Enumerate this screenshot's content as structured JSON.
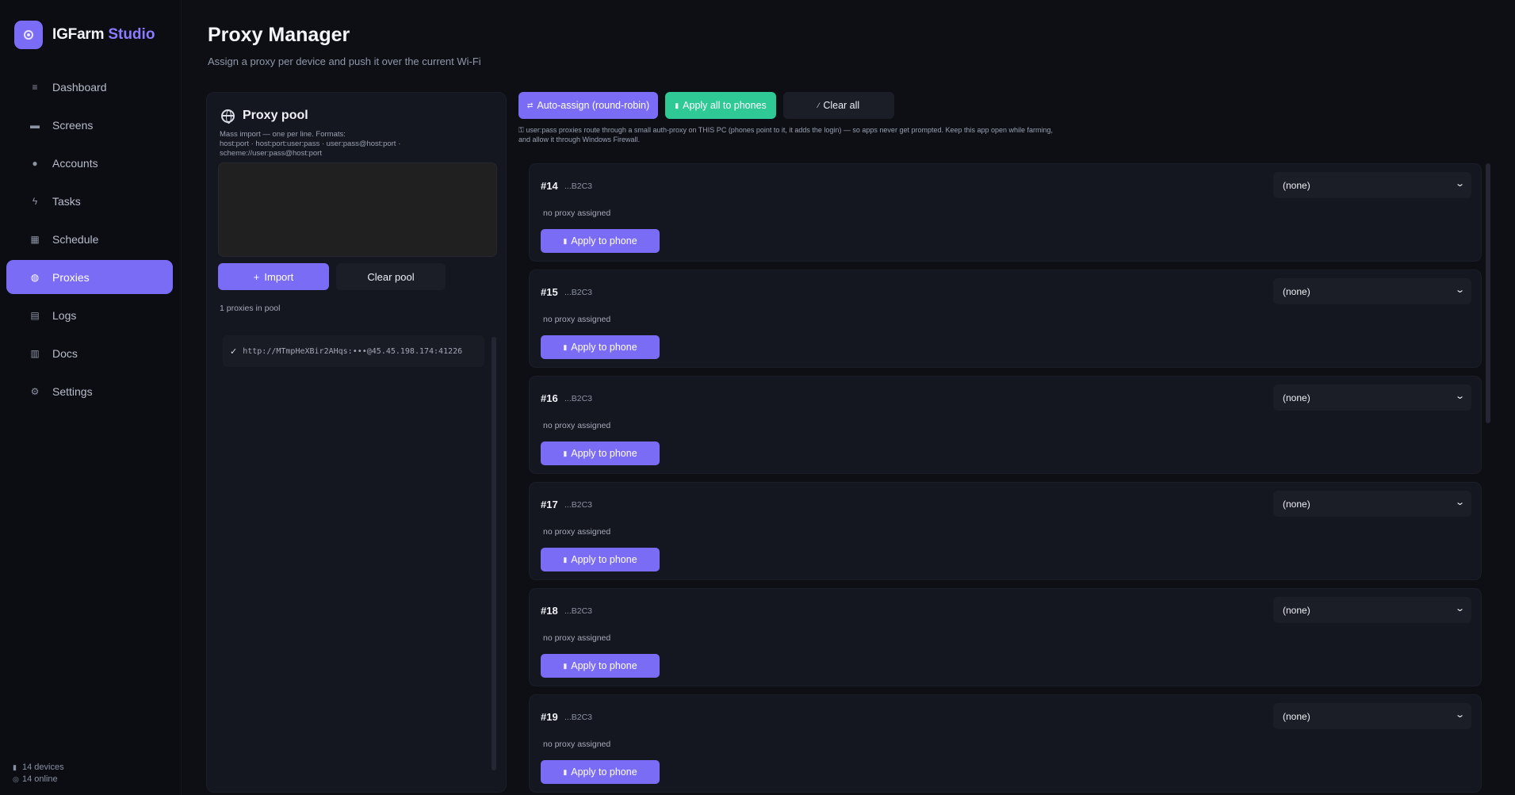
{
  "brand": {
    "name": "IGFarm",
    "accent": "Studio",
    "accent_color": "#8b7bff",
    "logo_icon": "target-icon"
  },
  "sidebar": {
    "items": [
      {
        "label": "Dashboard",
        "icon": "list-icon",
        "glyph": "≡",
        "active": false
      },
      {
        "label": "Screens",
        "icon": "monitor-icon",
        "glyph": "▬",
        "active": false
      },
      {
        "label": "Accounts",
        "icon": "user-icon",
        "glyph": "●",
        "active": false
      },
      {
        "label": "Tasks",
        "icon": "bolt-icon",
        "glyph": "ϟ",
        "active": false
      },
      {
        "label": "Schedule",
        "icon": "calendar-icon",
        "glyph": "▦",
        "active": false
      },
      {
        "label": "Proxies",
        "icon": "globe-icon",
        "glyph": "◍",
        "active": true
      },
      {
        "label": "Logs",
        "icon": "document-icon",
        "glyph": "▤",
        "active": false
      },
      {
        "label": "Docs",
        "icon": "book-icon",
        "glyph": "▥",
        "active": false
      },
      {
        "label": "Settings",
        "icon": "gear-icon",
        "glyph": "⚙",
        "active": false
      }
    ],
    "footer": {
      "devices": "14 devices",
      "online": "14 online"
    }
  },
  "header": {
    "title": "Proxy Manager",
    "subtitle": "Assign a proxy per device and push it over the current Wi-Fi"
  },
  "pool": {
    "title": "Proxy pool",
    "help_line1": "Mass import — one per line. Formats:",
    "help_line2": "host:port · host:port:user:pass · user:pass@host:port ·",
    "help_line3": "scheme://user:pass@host:port",
    "textarea_value": "",
    "import_label": "Import",
    "clear_label": "Clear pool",
    "count_text": "1 proxies in pool",
    "entries": [
      {
        "text": "http://MTmpHeXBir2AHqs:•••@45.45.198.174:41226",
        "valid": true
      }
    ]
  },
  "toolbar": {
    "auto_assign_label": "Auto-assign (round-robin)",
    "apply_all_label": "Apply all to phones",
    "clear_all_label": "Clear all",
    "note_line1": "user:pass proxies route through a small auth-proxy on THIS PC (phones point to it, it adds the login) — so apps never get prompted. Keep this app open while farming,",
    "note_line2": "and allow it through Windows Firewall.",
    "green_color": "#2fc995",
    "accent_color": "#7b6cf6"
  },
  "devices": [
    {
      "id": "#14",
      "serial": "...B2C3",
      "status": "no proxy assigned",
      "proxy": "(none)",
      "apply_label": "Apply to phone"
    },
    {
      "id": "#15",
      "serial": "...B2C3",
      "status": "no proxy assigned",
      "proxy": "(none)",
      "apply_label": "Apply to phone"
    },
    {
      "id": "#16",
      "serial": "...B2C3",
      "status": "no proxy assigned",
      "proxy": "(none)",
      "apply_label": "Apply to phone"
    },
    {
      "id": "#17",
      "serial": "...B2C3",
      "status": "no proxy assigned",
      "proxy": "(none)",
      "apply_label": "Apply to phone"
    },
    {
      "id": "#18",
      "serial": "...B2C3",
      "status": "no proxy assigned",
      "proxy": "(none)",
      "apply_label": "Apply to phone"
    },
    {
      "id": "#19",
      "serial": "...B2C3",
      "status": "no proxy assigned",
      "proxy": "(none)",
      "apply_label": "Apply to phone"
    }
  ]
}
